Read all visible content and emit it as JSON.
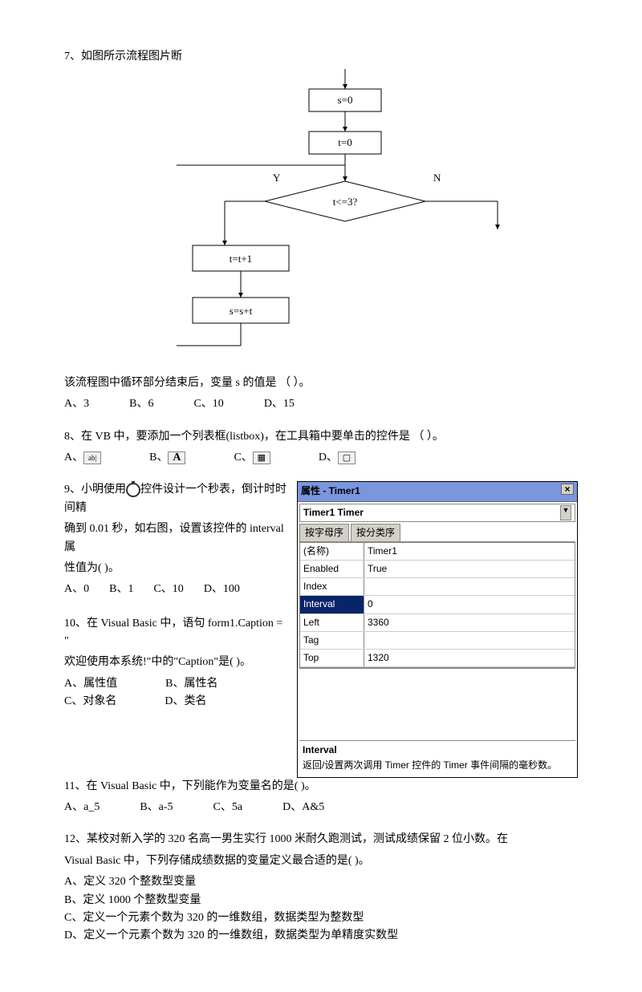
{
  "q7": {
    "title": "7、如图所示流程图片断",
    "flow": {
      "s0": "s=0",
      "t0": "t=0",
      "cond": "t<=3?",
      "yes": "Y",
      "no": "N",
      "step1": "t=t+1",
      "step2": "s=s+t"
    },
    "after": "该流程图中循环部分结束后，变量 s 的值是  （        ）。",
    "opts": {
      "a": "A、3",
      "b": "B、6",
      "c": "C、10",
      "d": "D、15"
    }
  },
  "q8": {
    "text": "8、在 VB 中，要添加一个列表框(listbox)，在工具箱中要单击的控件是  （       ）。",
    "opts": {
      "a": "A、",
      "b": "B、",
      "c": "C、",
      "d": "D、"
    },
    "icons": {
      "a": "ab|",
      "b": "A",
      "c": "▦",
      "d": "▢"
    }
  },
  "q9": {
    "line1_pre": "9、小明使用",
    "line1_post": "控件设计一个秒表，倒计时时间精",
    "line2": "确到 0.01 秒，如右图，设置该控件的 interval 属",
    "line3": "性值为(         )。",
    "opts": {
      "a": "A、0",
      "b": "B、1",
      "c": "C、10",
      "d": "D、100"
    }
  },
  "propWin": {
    "title": "属性 - Timer1",
    "combo": "Timer1 Timer",
    "tab1": "按字母序",
    "tab2": "按分类序",
    "rows": [
      {
        "k": "(名称)",
        "v": "Timer1"
      },
      {
        "k": "Enabled",
        "v": "True"
      },
      {
        "k": "Index",
        "v": ""
      },
      {
        "k": "Interval",
        "v": "0",
        "selected": true
      },
      {
        "k": "Left",
        "v": "3360"
      },
      {
        "k": "Tag",
        "v": ""
      },
      {
        "k": "Top",
        "v": "1320"
      }
    ],
    "descTitle": "Interval",
    "descBody": "返回/设置两次调用 Timer 控件的 Timer 事件间隔的毫秒数。"
  },
  "q10": {
    "l1": "10、在 Visual Basic 中，语句 form1.Caption = \"",
    "l2": "欢迎使用本系统!\"中的\"Caption\"是(         )。",
    "opts": {
      "a": "A、属性值",
      "b": "B、属性名",
      "c": "C、对象名",
      "d": "D、类名"
    }
  },
  "q11": {
    "text": "11、在 Visual Basic 中，下列能作为变量名的是(         )。",
    "opts": {
      "a": "A、a_5",
      "b": "B、a-5",
      "c": "C、5a",
      "d": "D、A&5"
    }
  },
  "q12": {
    "l1": "12、某校对新入学的 320 名高一男生实行 1000 米耐久跑测试，测试成绩保留 2 位小数。在",
    "l2": "Visual Basic 中，下列存储成绩数据的变量定义最合适的是(          )。",
    "a": "A、定义 320 个整数型变量",
    "b": "B、定义 1000 个整数型变量",
    "c": "C、定义一个元素个数为 320 的一维数组，数据类型为整数型",
    "d": "D、定义一个元素个数为 320 的一维数组，数据类型为单精度实数型"
  },
  "chart_data": {
    "type": "flowchart",
    "nodes": [
      {
        "id": "start",
        "type": "entry"
      },
      {
        "id": "n1",
        "type": "process",
        "text": "s=0"
      },
      {
        "id": "n2",
        "type": "process",
        "text": "t=0"
      },
      {
        "id": "d1",
        "type": "decision",
        "text": "t<=3?"
      },
      {
        "id": "n3",
        "type": "process",
        "text": "t=t+1"
      },
      {
        "id": "n4",
        "type": "process",
        "text": "s=s+t"
      }
    ],
    "edges": [
      {
        "from": "start",
        "to": "n1"
      },
      {
        "from": "n1",
        "to": "n2"
      },
      {
        "from": "n2",
        "to": "d1"
      },
      {
        "from": "d1",
        "to": "n3",
        "label": "Y"
      },
      {
        "from": "n3",
        "to": "n4"
      },
      {
        "from": "n4",
        "to": "d1"
      },
      {
        "from": "d1",
        "to": "exit",
        "label": "N"
      }
    ]
  }
}
